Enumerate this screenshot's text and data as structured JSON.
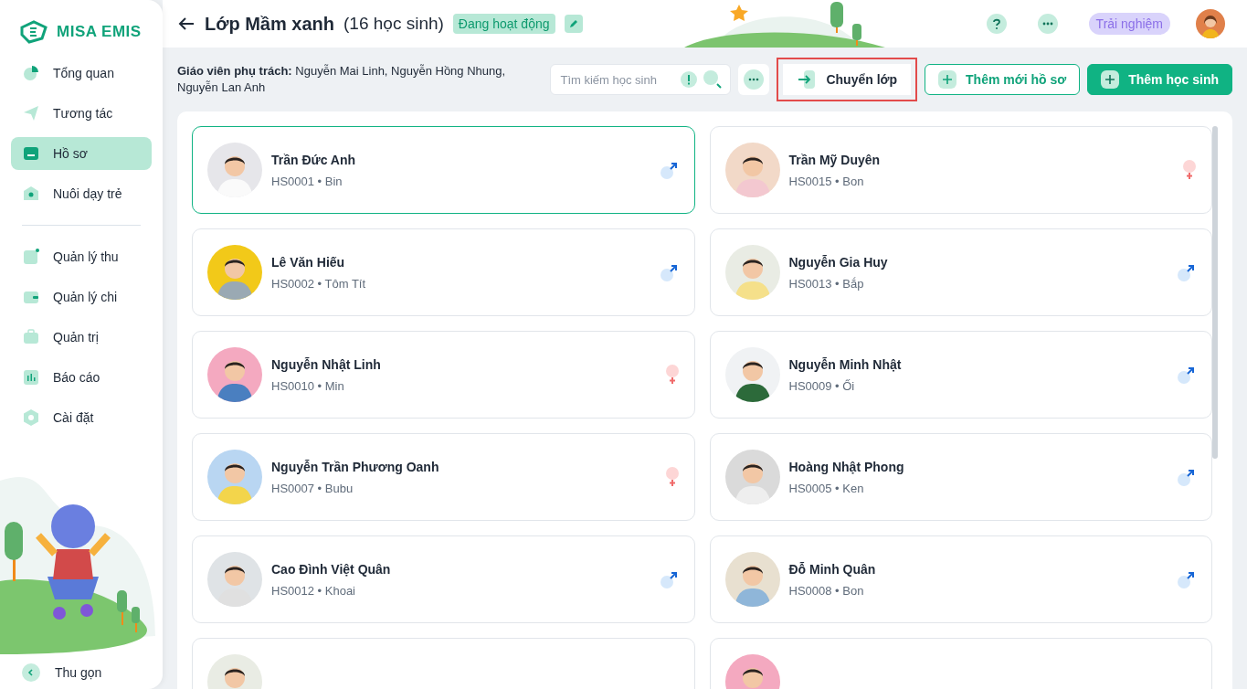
{
  "brand": {
    "name": "MISA EMIS"
  },
  "sidebar": {
    "groups": [
      [
        {
          "label": "Tổng quan",
          "selected": false
        },
        {
          "label": "Tương tác",
          "selected": false
        },
        {
          "label": "Hồ sơ",
          "selected": true
        },
        {
          "label": "Nuôi dạy trẻ",
          "selected": false
        }
      ],
      [
        {
          "label": "Quản lý thu",
          "selected": false
        },
        {
          "label": "Quản lý chi",
          "selected": false
        },
        {
          "label": "Quản trị",
          "selected": false
        },
        {
          "label": "Báo cáo",
          "selected": false
        },
        {
          "label": "Cài đặt",
          "selected": false
        }
      ]
    ],
    "collapse": "Thu gọn"
  },
  "header": {
    "title": "Lớp Mầm xanh",
    "count": "(16 học sinh)",
    "status": "Đang hoạt động",
    "trial": "Trải nghiệm"
  },
  "toolbar": {
    "teachers_label": "Giáo viên phụ trách:",
    "teachers": "Nguyễn Mai Linh, Nguyễn Hồng Nhung, Nguyễn Lan Anh",
    "search": {
      "placeholder": "Tìm kiếm học sinh"
    },
    "buttons": [
      {
        "label": "Chuyển lớp",
        "kind": "move",
        "highlighted": true
      },
      {
        "label": "Thêm mới hồ sơ",
        "kind": "outline",
        "highlighted": false
      },
      {
        "label": "Thêm học sinh",
        "kind": "primary",
        "highlighted": false
      }
    ]
  },
  "students": [
    {
      "name": "Trần Đức Anh",
      "info": "HS0001 • Bin",
      "kind": "male",
      "selected": true
    },
    {
      "name": "Trần Mỹ Duyên",
      "info": "HS0015 • Bon",
      "kind": "female",
      "selected": false
    },
    {
      "name": "Lê Văn Hiếu",
      "info": "HS0002 • Tôm Tít",
      "kind": "male",
      "selected": false
    },
    {
      "name": "Nguyễn Gia Huy",
      "info": "HS0013 • Bắp",
      "kind": "male",
      "selected": false
    },
    {
      "name": "Nguyễn Nhật Linh",
      "info": "HS0010 • Min",
      "kind": "female",
      "selected": false
    },
    {
      "name": "Nguyễn Minh Nhật",
      "info": "HS0009 • Ối",
      "kind": "male",
      "selected": false
    },
    {
      "name": "Nguyễn Trần Phương Oanh",
      "info": "HS0007 • Bubu",
      "kind": "female",
      "selected": false
    },
    {
      "name": "Hoàng Nhật Phong",
      "info": "HS0005 • Ken",
      "kind": "male",
      "selected": false
    },
    {
      "name": "Cao Đình Việt Quân",
      "info": "HS0012 • Khoai",
      "kind": "male",
      "selected": false
    },
    {
      "name": "Đỗ Minh Quân",
      "info": "HS0008 • Bon",
      "kind": "male",
      "selected": false
    }
  ]
}
